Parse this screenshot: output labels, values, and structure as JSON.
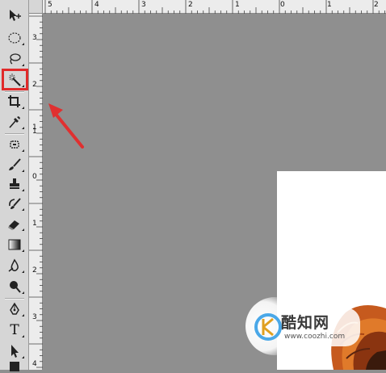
{
  "toolbar": {
    "tools": [
      {
        "name": "move-tool-icon"
      },
      {
        "name": "elliptical-marquee-tool-icon"
      },
      {
        "name": "lasso-tool-icon"
      },
      {
        "name": "magic-wand-tool-icon",
        "highlighted": true
      },
      {
        "name": "crop-tool-icon"
      },
      {
        "name": "eyedropper-tool-icon"
      },
      {
        "name": "spot-healing-brush-icon"
      },
      {
        "name": "brush-tool-icon"
      },
      {
        "name": "clone-stamp-tool-icon"
      },
      {
        "name": "history-brush-icon"
      },
      {
        "name": "eraser-tool-icon"
      },
      {
        "name": "gradient-tool-icon"
      },
      {
        "name": "blur-tool-icon"
      },
      {
        "name": "dodge-tool-icon"
      },
      {
        "name": "pen-tool-icon"
      },
      {
        "name": "type-tool-icon"
      },
      {
        "name": "path-selection-tool-icon"
      }
    ],
    "type_tool_glyph": "T"
  },
  "rulers": {
    "horizontal_labels": [
      "5",
      "4",
      "3",
      "2",
      "1",
      "0",
      "1",
      "2"
    ],
    "vertical_labels": [
      "3",
      "2",
      "1",
      "1",
      "0",
      "1",
      "2",
      "3",
      "4"
    ]
  },
  "annotation": {
    "highlight_color": "#e02a2a",
    "arrow_color": "#e03030"
  },
  "watermark": {
    "brand": "酷知网",
    "url": "www.coozhi.com"
  }
}
